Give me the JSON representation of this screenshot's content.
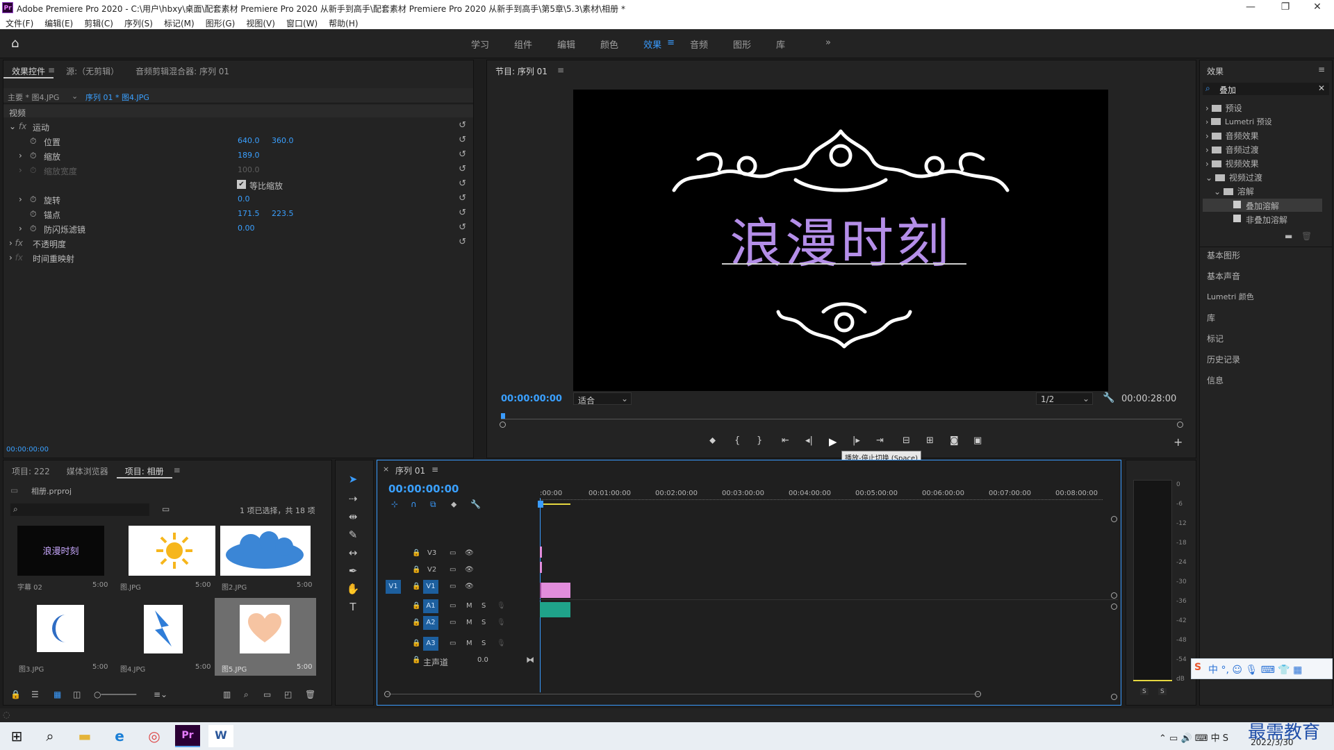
{
  "window": {
    "title": "Adobe Premiere Pro 2020 - C:\\用户\\hbxy\\桌面\\配套素材 Premiere Pro 2020 从新手到高手\\配套素材 Premiere Pro 2020 从新手到高手\\第5章\\5.3\\素材\\相册 *",
    "app_icon": "Pr"
  },
  "menu": [
    "文件(F)",
    "编辑(E)",
    "剪辑(C)",
    "序列(S)",
    "标记(M)",
    "图形(G)",
    "视图(V)",
    "窗口(W)",
    "帮助(H)"
  ],
  "workspaces": {
    "tabs": [
      "学习",
      "组件",
      "编辑",
      "颜色",
      "效果",
      "音频",
      "图形",
      "库"
    ],
    "active": "效果",
    "more": "»"
  },
  "effect_controls": {
    "tabs": [
      "效果控件",
      "源:（无剪辑）",
      "音频剪辑混合器: 序列 01"
    ],
    "active_tab": "效果控件",
    "master": "主要 * 图4.JPG",
    "sequence": "序列 01 * 图4.JPG",
    "section_video": "视频",
    "motion": "运动",
    "position": {
      "label": "位置",
      "x": "640.0",
      "y": "360.0"
    },
    "scale": {
      "label": "缩放",
      "value": "189.0"
    },
    "scale_width": {
      "label": "缩放宽度",
      "value": "100.0"
    },
    "uniform_scale": "等比缩放",
    "rotation": {
      "label": "旋转",
      "value": "0.0"
    },
    "anchor": {
      "label": "锚点",
      "x": "171.5",
      "y": "223.5"
    },
    "antiflicker": {
      "label": "防闪烁滤镜",
      "value": "0.00"
    },
    "opacity": "不透明度",
    "time_remap": "时间重映射",
    "timecode": "00:00:00:00"
  },
  "program": {
    "title": "节目: 序列 01",
    "video_text": "浪漫时刻",
    "timecode": "00:00:00:00",
    "fit": "适合",
    "resolution": "1/2",
    "duration": "00:00:28:00",
    "tooltip": "播放-停止切换 (Space)"
  },
  "effects_panel": {
    "title": "效果",
    "search": "叠加",
    "tree": [
      "预设",
      "Lumetri 预设",
      "音频效果",
      "音频过渡",
      "视频效果",
      "视频过渡",
      "溶解",
      "叠加溶解",
      "非叠加溶解"
    ],
    "selected": "叠加溶解",
    "sections": [
      "基本图形",
      "基本声音",
      "Lumetri 颜色",
      "库",
      "标记",
      "历史记录",
      "信息"
    ]
  },
  "project": {
    "tabs": [
      "项目: 222",
      "媒体浏览器",
      "项目: 相册"
    ],
    "active_tab": "项目: 相册",
    "file": "相册.prproj",
    "selection_info": "1 项已选择，共 18 项",
    "items": [
      {
        "name": "字幕 02",
        "dur": "5:00"
      },
      {
        "name": "图.JPG",
        "dur": "5:00"
      },
      {
        "name": "图2.JPG",
        "dur": "5:00"
      },
      {
        "name": "图3.JPG",
        "dur": "5:00"
      },
      {
        "name": "图4.JPG",
        "dur": "5:00"
      },
      {
        "name": "图5.JPG",
        "dur": "5:00"
      }
    ],
    "thumb_caption": "浪漫时刻"
  },
  "timeline": {
    "title": "序列 01",
    "timecode": "00:00:00:00",
    "ruler": [
      ":00:00",
      "00:01:00:00",
      "00:02:00:00",
      "00:03:00:00",
      "00:04:00:00",
      "00:05:00:00",
      "00:06:00:00",
      "00:07:00:00",
      "00:08:00:00"
    ],
    "video_tracks": [
      "V3",
      "V2",
      "V1"
    ],
    "audio_tracks": [
      "A1",
      "A2",
      "A3"
    ],
    "source_patch": "V1",
    "master": {
      "label": "主声道",
      "value": "0.0"
    },
    "mute": "M",
    "solo": "S"
  },
  "meter": {
    "scale": [
      "0",
      "-6",
      "-12",
      "-18",
      "-24",
      "-30",
      "-36",
      "-42",
      "-48",
      "-54",
      "dB"
    ],
    "solo_labels": [
      "S",
      "S"
    ]
  },
  "taskbar": {
    "time": "2022/3/30",
    "watermark": "最需教育"
  },
  "colors": {
    "accent": "#3a9cff",
    "panel": "#232323",
    "bg": "#1d1d1d",
    "clip_video": "#e28ddc",
    "clip_audio": "#1fa38a"
  }
}
